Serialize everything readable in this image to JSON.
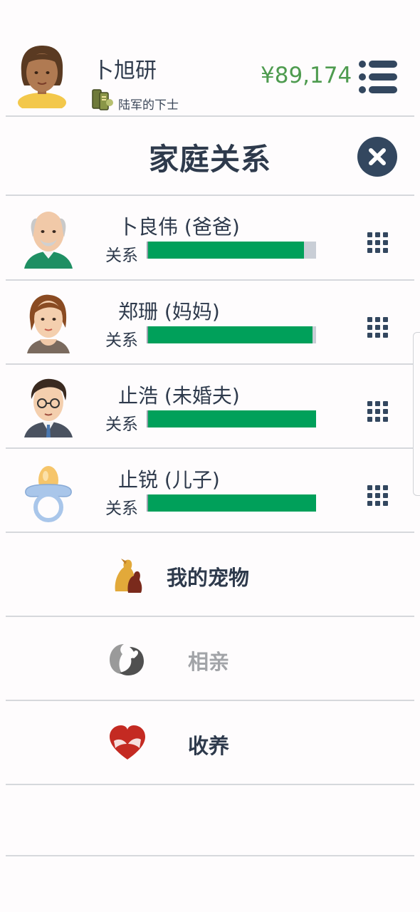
{
  "player": {
    "name": "卜旭研",
    "rank": "陆军的下士",
    "money": "¥89,174"
  },
  "page": {
    "title": "家庭关系"
  },
  "family": [
    {
      "name": "卜良伟 (爸爸)",
      "relation_label": "关系",
      "relation": 0.93,
      "face": "grandpa-face-icon"
    },
    {
      "name": "郑珊 (妈妈)",
      "relation_label": "关系",
      "relation": 0.98,
      "face": "woman-face-icon"
    },
    {
      "name": "止浩 (未婚夫)",
      "relation_label": "关系",
      "relation": 1.0,
      "face": "man-glasses-face-icon"
    },
    {
      "name": "止锐 (儿子)",
      "relation_label": "关系",
      "relation": 1.0,
      "face": "pacifier-icon"
    }
  ],
  "actions": {
    "pets": "我的宠物",
    "dating": "相亲",
    "adopt": "收养"
  },
  "colors": {
    "accent": "#00a05a",
    "money": "#4e9b4f",
    "dark": "#33475f",
    "bar_bg": "#c9ced6"
  }
}
